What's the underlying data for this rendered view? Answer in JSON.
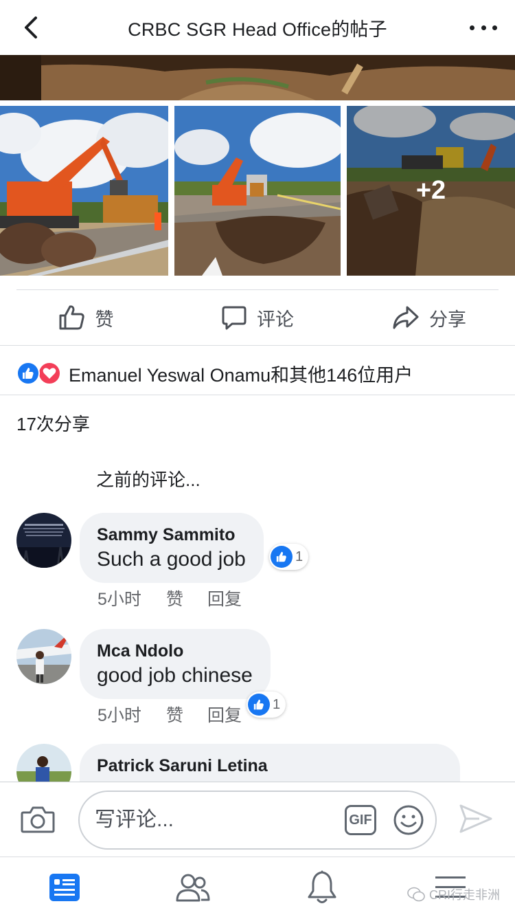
{
  "header": {
    "title": "CRBC SGR Head Office的帖子",
    "back_icon": "chevron-left-icon",
    "more_icon": "more-dots-icon"
  },
  "photos": {
    "extra_count_label": "+2"
  },
  "actions": {
    "like_label": "赞",
    "comment_label": "评论",
    "share_label": "分享"
  },
  "reactions": {
    "summary": "Emanuel Yeswal Onamu和其他146位用户",
    "types": [
      "like",
      "love"
    ]
  },
  "shares_label": "17次分享",
  "previous_comments_label": "之前的评论...",
  "comments": [
    {
      "name": "Sammy Sammito",
      "text": "Such a good job",
      "time": "5小时",
      "like_label": "赞",
      "reply_label": "回复",
      "like_count": "1"
    },
    {
      "name": "Mca Ndolo",
      "text": "good job chinese",
      "time": "5小时",
      "like_label": "赞",
      "reply_label": "回复",
      "like_count": "1"
    },
    {
      "name": "Patrick Saruni Letina"
    }
  ],
  "composer": {
    "placeholder": "写评论...",
    "gif_label": "GIF"
  },
  "nav": {
    "items": [
      "news-feed-icon",
      "friends-icon",
      "notifications-icon",
      "menu-icon"
    ]
  },
  "watermark": "CRI行走非洲",
  "colors": {
    "accent": "#1877f2",
    "love": "#f33e58",
    "bubble": "#f0f2f5",
    "muted": "#65676b"
  }
}
